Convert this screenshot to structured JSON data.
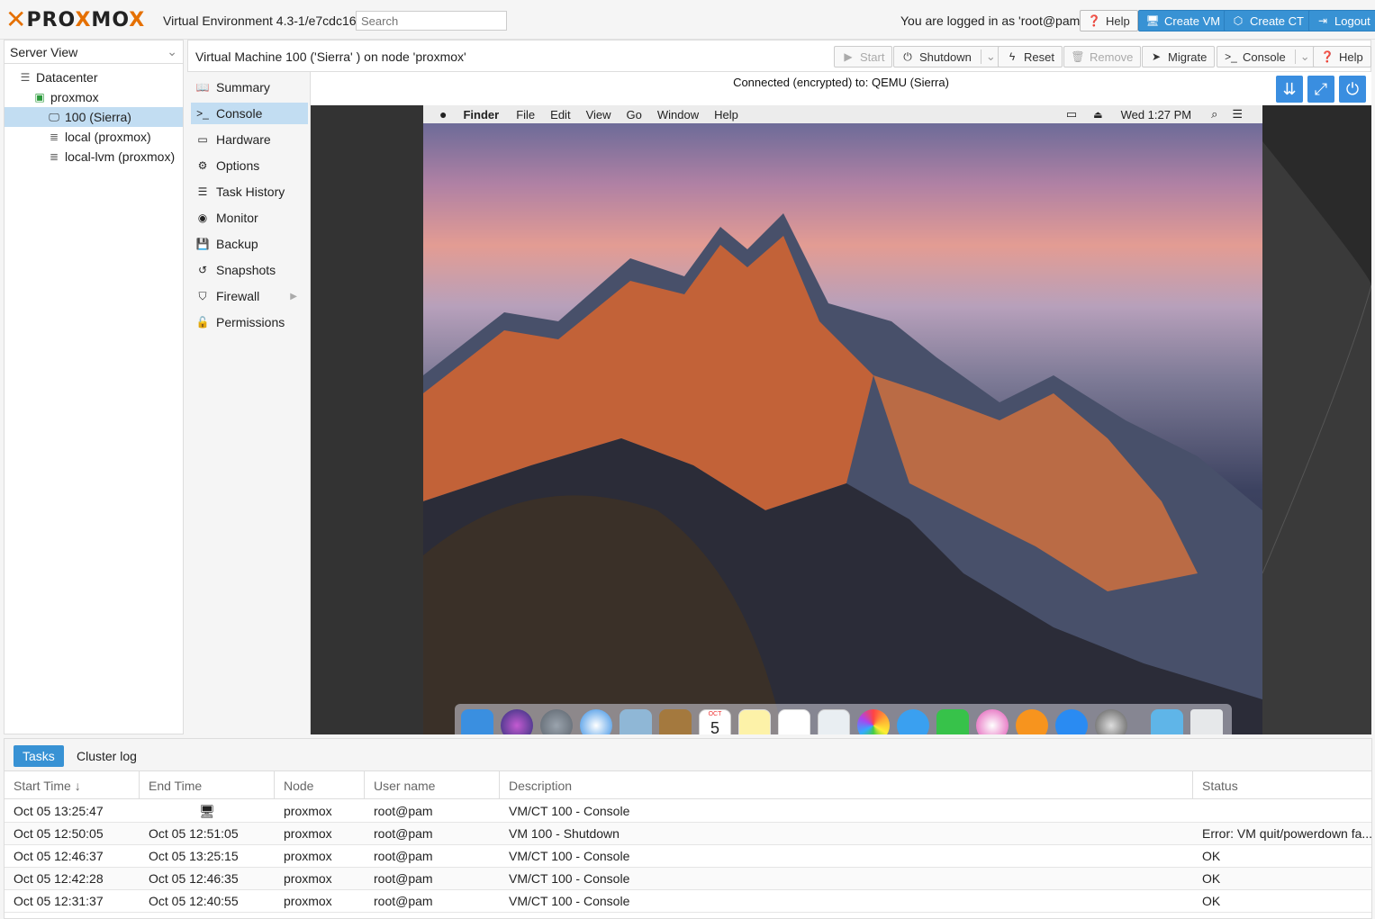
{
  "header": {
    "brand": "PROXMOX",
    "version": "Virtual Environment 4.3-1/e7cdc165",
    "search_placeholder": "Search",
    "logged_in": "You are logged in as 'root@pam'",
    "help_label": "Help",
    "create_vm_label": "Create VM",
    "create_ct_label": "Create CT",
    "logout_label": "Logout"
  },
  "tree": {
    "view_selector": "Server View",
    "nodes": [
      {
        "label": "Datacenter"
      },
      {
        "label": "proxmox"
      },
      {
        "label": "100 (Sierra)"
      },
      {
        "label": "local (proxmox)"
      },
      {
        "label": "local-lvm (proxmox)"
      }
    ]
  },
  "content": {
    "title": "Virtual Machine 100 ('Sierra' ) on node 'proxmox'",
    "buttons": {
      "start": "Start",
      "shutdown": "Shutdown",
      "reset": "Reset",
      "remove": "Remove",
      "migrate": "Migrate",
      "console": "Console",
      "help": "Help"
    }
  },
  "nav": {
    "items": [
      {
        "label": "Summary",
        "icon": "book-icon"
      },
      {
        "label": "Console",
        "icon": "terminal-icon"
      },
      {
        "label": "Hardware",
        "icon": "monitor-icon"
      },
      {
        "label": "Options",
        "icon": "gear-icon"
      },
      {
        "label": "Task History",
        "icon": "list-icon"
      },
      {
        "label": "Monitor",
        "icon": "eye-icon"
      },
      {
        "label": "Backup",
        "icon": "floppy-icon"
      },
      {
        "label": "Snapshots",
        "icon": "history-icon"
      },
      {
        "label": "Firewall",
        "icon": "shield-icon"
      },
      {
        "label": "Permissions",
        "icon": "unlock-icon"
      }
    ]
  },
  "console": {
    "status": "Connected (encrypted) to: QEMU (Sierra)",
    "menubar": {
      "app": "Finder",
      "menus": [
        "File",
        "Edit",
        "View",
        "Go",
        "Window",
        "Help"
      ],
      "clock": "Wed 1:27 PM"
    },
    "calendar_day": "5",
    "calendar_month": "OCT"
  },
  "tasks": {
    "tabs": [
      "Tasks",
      "Cluster log"
    ],
    "columns": [
      "Start Time",
      "End Time",
      "Node",
      "User name",
      "Description",
      "Status"
    ],
    "rows": [
      [
        "Oct 05 13:25:47",
        "",
        "proxmox",
        "root@pam",
        "VM/CT 100 - Console",
        ""
      ],
      [
        "Oct 05 12:50:05",
        "Oct 05 12:51:05",
        "proxmox",
        "root@pam",
        "VM 100 - Shutdown",
        "Error: VM quit/powerdown fa..."
      ],
      [
        "Oct 05 12:46:37",
        "Oct 05 13:25:15",
        "proxmox",
        "root@pam",
        "VM/CT 100 - Console",
        "OK"
      ],
      [
        "Oct 05 12:42:28",
        "Oct 05 12:46:35",
        "proxmox",
        "root@pam",
        "VM/CT 100 - Console",
        "OK"
      ],
      [
        "Oct 05 12:31:37",
        "Oct 05 12:40:55",
        "proxmox",
        "root@pam",
        "VM/CT 100 - Console",
        "OK"
      ]
    ]
  },
  "colors": {
    "accent": "#3892d4",
    "brand_orange": "#e57000",
    "selection": "#c2ddf2"
  }
}
